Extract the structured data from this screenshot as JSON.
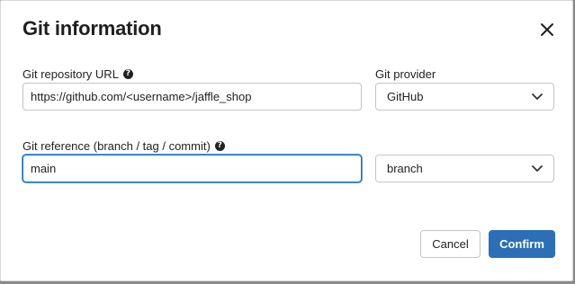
{
  "dialog": {
    "title": "Git information"
  },
  "repo_url": {
    "label": "Git repository URL",
    "value": "https://github.com/<username>/jaffle_shop"
  },
  "provider": {
    "label": "Git provider",
    "selected": "GitHub"
  },
  "reference": {
    "label": "Git reference (branch / tag / commit)",
    "value": "main"
  },
  "reference_type": {
    "selected": "branch"
  },
  "actions": {
    "cancel_label": "Cancel",
    "confirm_label": "Confirm"
  },
  "icons": {
    "close": "close-icon",
    "help": "question-circle-icon",
    "chevron": "chevron-down-icon"
  },
  "colors": {
    "primary": "#2c6fb7",
    "focus_border": "#1f6fb5"
  }
}
